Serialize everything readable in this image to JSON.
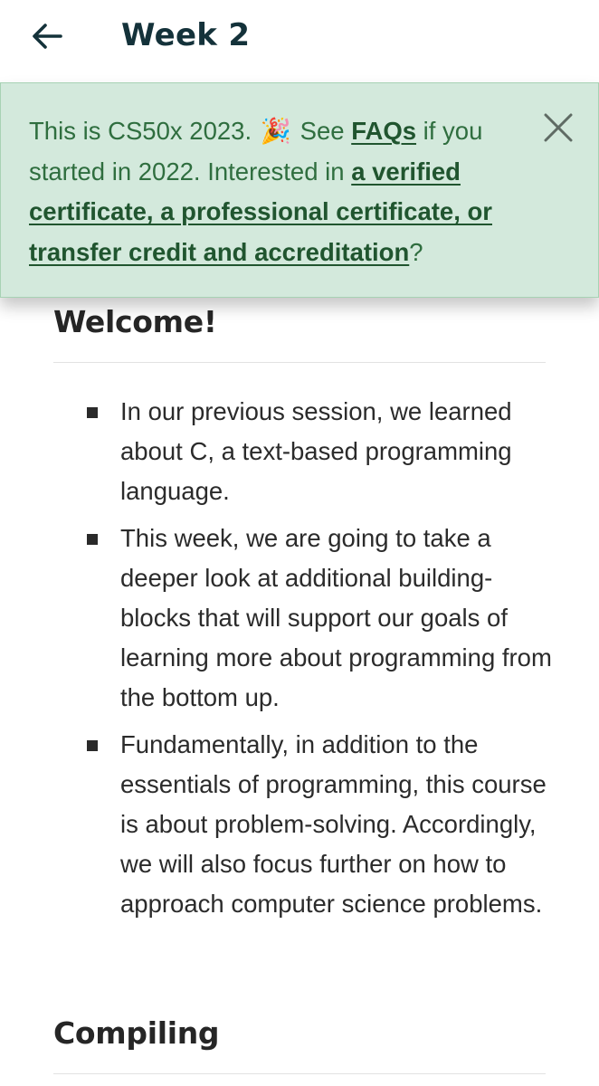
{
  "header": {
    "back_icon": "arrow-left-icon",
    "title": "Week 2"
  },
  "banner": {
    "text_1": "This is CS50x 2023.",
    "emoji": "🎉",
    "text_2": "See",
    "faqs_link": "FAQs",
    "text_3": "if you started in 2022. Interested in",
    "cert_link": "a verified certificate, a professional certificate, or transfer credit and accreditation",
    "text_4": "?",
    "close_icon": "close-icon",
    "colors": {
      "background": "#d3e9dc",
      "text": "#2f6e3f",
      "link": "#20552f"
    }
  },
  "sections": [
    {
      "heading": "Welcome!",
      "bullets": [
        "In our previous session, we learned about C, a text-based programming language.",
        "This week, we are going to take a deeper look at additional building-blocks that will support our goals of learning more about programming from the bottom up.",
        "Fundamentally, in addition to the essentials of programming, this course is about problem-solving. Accordingly, we will also focus further on how to approach computer science problems."
      ]
    },
    {
      "heading": "Compiling"
    }
  ]
}
